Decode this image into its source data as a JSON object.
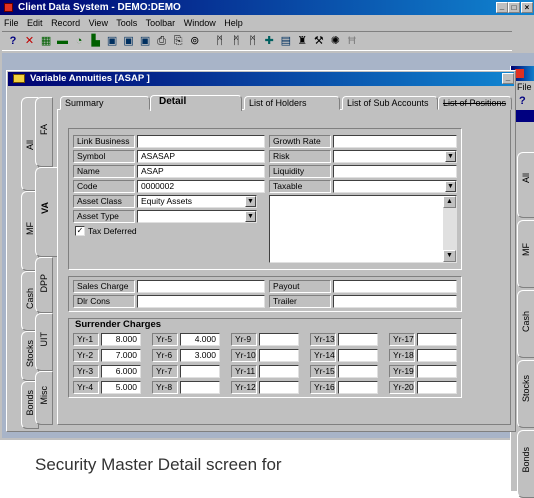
{
  "app": {
    "title": "Client Data System - DEMO:DEMO",
    "menu": [
      "File",
      "Edit",
      "Record",
      "View",
      "Tools",
      "Toolbar",
      "Window",
      "Help"
    ],
    "toolbar_icons": [
      "help-icon",
      "delete-icon",
      "calculator-icon",
      "minus-icon",
      "chart-icon",
      "building-icon",
      "grid-icon",
      "grid-icon",
      "grid-icon",
      "folder-icon",
      "copy-icon",
      "settings-icon",
      "binoculars-icon",
      "binoculars-icon",
      "binoculars-icon",
      "plus-icon",
      "save-icon",
      "trash-icon",
      "tools-icon",
      "gear-icon",
      "exit-icon"
    ]
  },
  "window": {
    "title": "Variable Annuities [ASAP ]",
    "side_tabs": [
      {
        "outer": "All",
        "inner": "FA"
      },
      {
        "outer": "MF",
        "inner": "VA"
      },
      {
        "outer": "Cash",
        "inner": "DPP"
      },
      {
        "outer": "Stocks",
        "inner": "UIT"
      },
      {
        "outer": "Bonds",
        "inner": "Misc"
      }
    ],
    "tabs": [
      "Summary",
      "Detail",
      "List of Holders",
      "List of Sub Accounts",
      "List of Positions"
    ],
    "active_tab": "Detail"
  },
  "detail": {
    "link_business": {
      "label": "Link Business",
      "value": ""
    },
    "symbol": {
      "label": "Symbol",
      "value": "ASASAP"
    },
    "name": {
      "label": "Name",
      "value": "ASAP"
    },
    "code": {
      "label": "Code",
      "value": "0000002"
    },
    "asset_class": {
      "label": "Asset Class",
      "value": "Equity Assets"
    },
    "asset_type": {
      "label": "Asset Type",
      "value": ""
    },
    "tax_deferred": {
      "label": "Tax Deferred",
      "checked": true
    },
    "growth_rate": {
      "label": "Growth Rate",
      "value": ""
    },
    "risk": {
      "label": "Risk",
      "value": ""
    },
    "liquidity": {
      "label": "Liquidity",
      "value": ""
    },
    "taxable": {
      "label": "Taxable",
      "value": ""
    },
    "sales_charge": {
      "label": "Sales Charge",
      "value": ""
    },
    "dlr_cons": {
      "label": "Dlr Cons",
      "value": ""
    },
    "payout": {
      "label": "Payout",
      "value": ""
    },
    "trailer": {
      "label": "Trailer",
      "value": ""
    }
  },
  "surrender": {
    "title": "Surrender Charges",
    "years": [
      {
        "label": "Yr-1",
        "value": "8.000"
      },
      {
        "label": "Yr-2",
        "value": "7.000"
      },
      {
        "label": "Yr-3",
        "value": "6.000"
      },
      {
        "label": "Yr-4",
        "value": "5.000"
      },
      {
        "label": "Yr-5",
        "value": "4.000"
      },
      {
        "label": "Yr-6",
        "value": "3.000"
      },
      {
        "label": "Yr-7",
        "value": ""
      },
      {
        "label": "Yr-8",
        "value": ""
      },
      {
        "label": "Yr-9",
        "value": ""
      },
      {
        "label": "Yr-10",
        "value": ""
      },
      {
        "label": "Yr-11",
        "value": ""
      },
      {
        "label": "Yr-12",
        "value": ""
      },
      {
        "label": "Yr-13",
        "value": ""
      },
      {
        "label": "Yr-14",
        "value": ""
      },
      {
        "label": "Yr-15",
        "value": ""
      },
      {
        "label": "Yr-16",
        "value": ""
      },
      {
        "label": "Yr-17",
        "value": ""
      },
      {
        "label": "Yr-18",
        "value": ""
      },
      {
        "label": "Yr-19",
        "value": ""
      },
      {
        "label": "Yr-20",
        "value": ""
      }
    ]
  },
  "background_window": {
    "menu_first": "File",
    "side_tabs": [
      "All",
      "MF",
      "Cash",
      "Stocks",
      "Bonds"
    ]
  },
  "caption": "Security Master Detail screen for"
}
